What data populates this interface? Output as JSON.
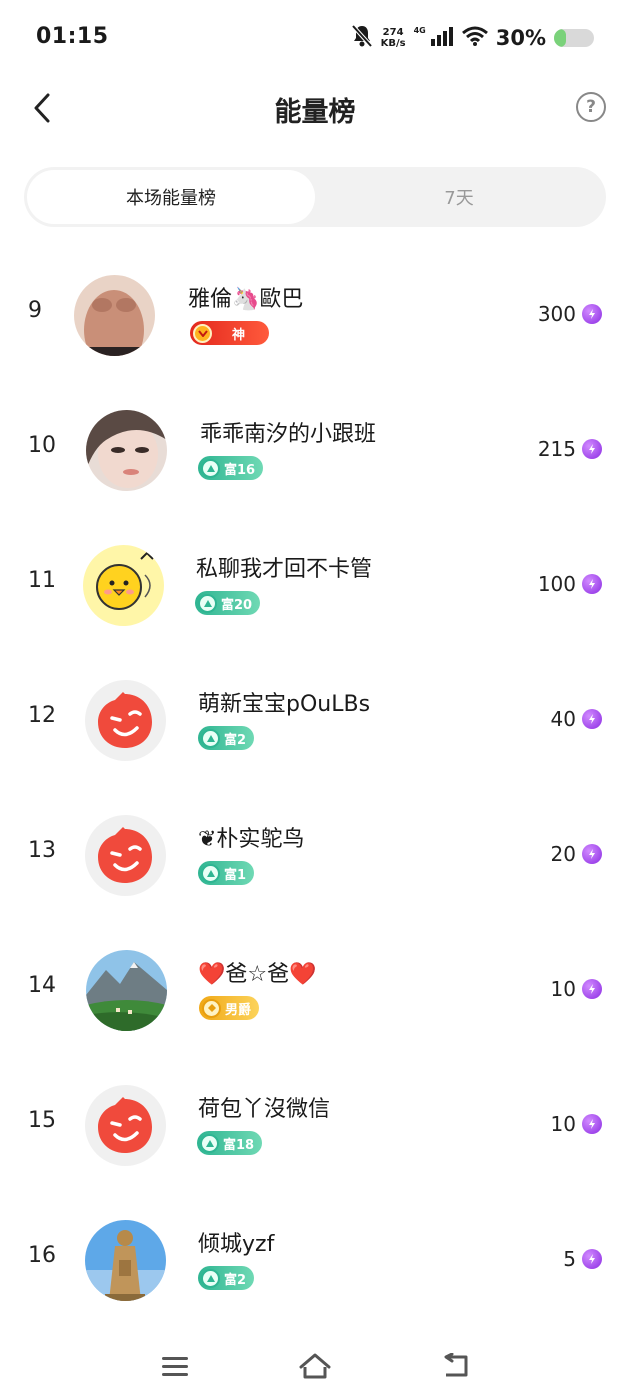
{
  "status_bar": {
    "time": "01:15",
    "net_speed_value": "274",
    "net_speed_unit": "KB/s",
    "signal_tag": "4G",
    "battery_text": "30%",
    "battery_level": 0.3,
    "icons": [
      "bell-off-icon",
      "signal-icon",
      "wifi-icon",
      "battery-icon"
    ]
  },
  "header": {
    "title": "能量榜",
    "back_icon": "chevron-left-icon",
    "help_symbol": "?"
  },
  "tabs": [
    {
      "label": "本场能量榜",
      "active": true
    },
    {
      "label": "7天",
      "active": false
    }
  ],
  "ranking": [
    {
      "rank": "9",
      "name": "雅倫🦄歐巴",
      "badge": "神",
      "badge_type": "red",
      "score": "300",
      "avatar": "shirtless-man-photo"
    },
    {
      "rank": "10",
      "name": "乖乖南汐的小跟班",
      "badge": "富16",
      "badge_type": "green",
      "score": "215",
      "avatar": "woman-face-photo"
    },
    {
      "rank": "11",
      "name": "私聊我才回不卡管",
      "badge": "富20",
      "badge_type": "green",
      "score": "100",
      "avatar": "yellow-chick-cartoon"
    },
    {
      "rank": "12",
      "name": "萌新宝宝pOuLBs",
      "badge": "富2",
      "badge_type": "green",
      "score": "40",
      "avatar": "default-red-wink-avatar"
    },
    {
      "rank": "13",
      "name": "❦朴实鸵鸟",
      "badge": "富1",
      "badge_type": "green",
      "score": "20",
      "avatar": "default-red-wink-avatar"
    },
    {
      "rank": "14",
      "name": "❤️爸☆爸❤️",
      "badge": "男爵",
      "badge_type": "gold",
      "score": "10",
      "avatar": "mountain-landscape-photo"
    },
    {
      "rank": "15",
      "name": "荷包丫沒微信",
      "badge": "富18",
      "badge_type": "green",
      "score": "10",
      "avatar": "default-red-wink-avatar"
    },
    {
      "rank": "16",
      "name": "倾城yzf",
      "badge": "富2",
      "badge_type": "green",
      "score": "5",
      "avatar": "buddha-statue-photo"
    }
  ],
  "colors": {
    "accent_purple": "#8a2be2",
    "badge_green": "#2fb592",
    "badge_red": "#e3281d",
    "badge_gold": "#f0a816",
    "default_avatar_red": "#f04a3c"
  },
  "navbar": {
    "icons": [
      "menu-icon",
      "home-icon",
      "back-icon"
    ]
  }
}
